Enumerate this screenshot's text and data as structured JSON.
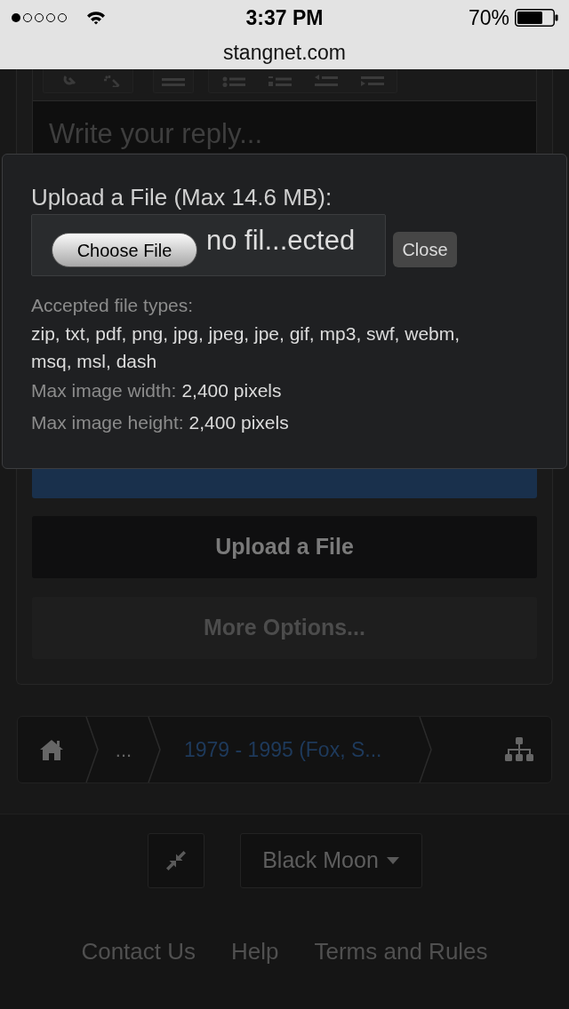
{
  "status_bar": {
    "time": "3:37 PM",
    "battery": "70%"
  },
  "browser": {
    "url": "stangnet.com"
  },
  "editor": {
    "placeholder": "Write your reply..."
  },
  "upload_dialog": {
    "title": "Upload a File (Max 14.6 MB):",
    "choose_button": "Choose File",
    "file_status": "no fil...ected",
    "close_button": "Close",
    "accepted_label": "Accepted file types:",
    "accepted_types": "zip, txt, pdf, png, jpg, jpeg, jpe, gif, mp3, swf, webm, msq, msl, dash",
    "limits": [
      {
        "label": "Max image width:",
        "value": "2,400 pixels"
      },
      {
        "label": "Max image height:",
        "value": "2,400 pixels"
      }
    ]
  },
  "actions": [
    {
      "kind": "primary"
    },
    {
      "label": "Upload a File",
      "kind": "dark"
    },
    {
      "label": "More Options...",
      "kind": "muted"
    }
  ],
  "breadcrumb": {
    "items": [
      {
        "kind": "home"
      },
      {
        "kind": "text",
        "label": "..."
      },
      {
        "kind": "link",
        "label": "1979 - 1995 (Fox, S..."
      }
    ]
  },
  "footer": {
    "style_chooser": "Black Moon",
    "links": [
      "Contact Us",
      "Help",
      "Terms and Rules"
    ]
  }
}
